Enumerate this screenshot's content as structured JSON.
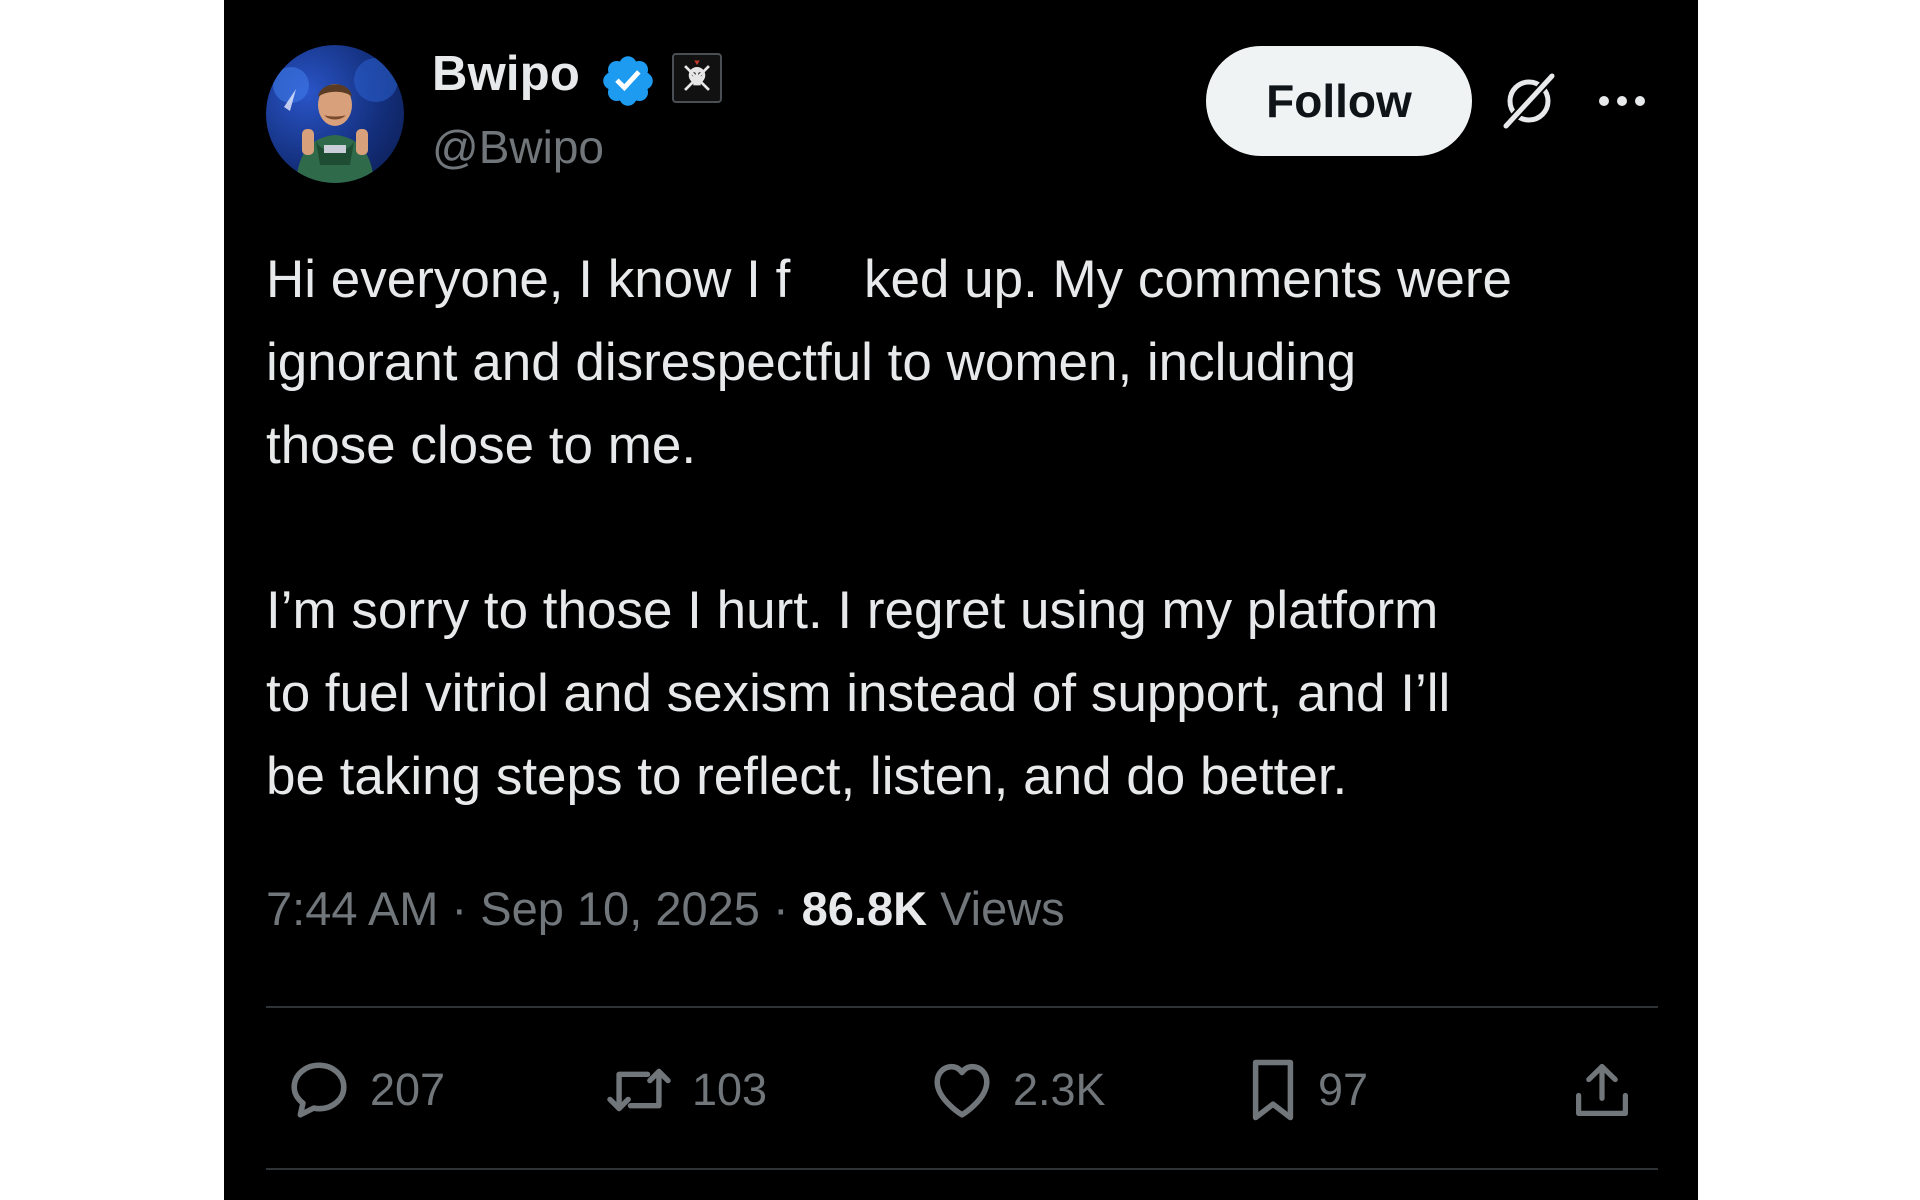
{
  "author": {
    "display_name": "Bwipo",
    "handle": "@Bwipo"
  },
  "header": {
    "follow_label": "Follow"
  },
  "tweet": {
    "paragraph_1": "Hi everyone, I know I f     ked up. My comments were\nignorant and disrespectful to women, including\nthose close to me.",
    "paragraph_2": "I’m sorry to those I hurt. I regret using my platform\nto fuel vitriol and sexism instead of support, and I’ll\nbe taking steps to reflect, listen, and do better."
  },
  "meta": {
    "time": "7:44 AM",
    "separator": "·",
    "date": "Sep 10, 2025",
    "views_count": "86.8K",
    "views_label": "Views"
  },
  "actions": {
    "replies": "207",
    "reposts": "103",
    "likes": "2.3K",
    "bookmarks": "97"
  },
  "icons": {
    "verified": "verified-badge-icon",
    "affiliate": "affiliate-badge-icon",
    "grok": "grok-icon",
    "more": "more-icon",
    "reply": "reply-icon",
    "repost": "repost-icon",
    "like": "heart-icon",
    "bookmark": "bookmark-icon",
    "share": "share-icon"
  },
  "colors": {
    "background": "#000000",
    "text_primary": "#e7e9ea",
    "text_secondary": "#71767b",
    "verified_blue": "#1d9bf0",
    "follow_bg": "#eff3f4",
    "divider": "#2f3336"
  }
}
